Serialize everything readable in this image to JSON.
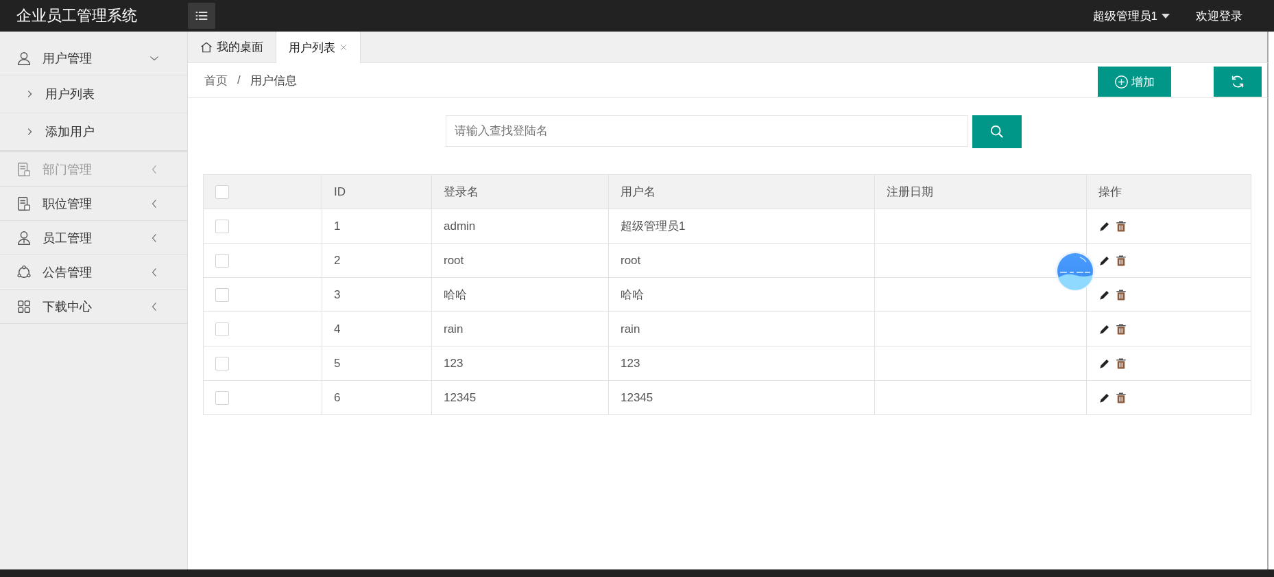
{
  "header": {
    "title": "企业员工管理系统",
    "user": "超级管理员1",
    "welcome": "欢迎登录"
  },
  "sidebar": {
    "items": [
      {
        "label": "用户管理",
        "kind": "person",
        "expanded": true,
        "disabled": false,
        "children": [
          {
            "label": "用户列表"
          },
          {
            "label": "添加用户"
          }
        ]
      },
      {
        "label": "部门管理",
        "kind": "doc",
        "expanded": false,
        "disabled": true
      },
      {
        "label": "职位管理",
        "kind": "doc",
        "expanded": false,
        "disabled": false
      },
      {
        "label": "员工管理",
        "kind": "staff",
        "expanded": false,
        "disabled": false
      },
      {
        "label": "公告管理",
        "kind": "share",
        "expanded": false,
        "disabled": false
      },
      {
        "label": "下载中心",
        "kind": "grid",
        "expanded": false,
        "disabled": false
      }
    ]
  },
  "tabs": [
    {
      "label": "我的桌面",
      "kind": "home",
      "selected": false
    },
    {
      "label": "用户列表",
      "kind": "closable",
      "selected": true
    }
  ],
  "breadcrumb": {
    "separator": "/",
    "items": [
      "首页",
      "用户信息"
    ]
  },
  "toolbar": {
    "add_button": "增加"
  },
  "search": {
    "placeholder": "请输入查找登陆名"
  },
  "table": {
    "select_all_checked": false,
    "columns": [
      "ID",
      "登录名",
      "用户名",
      "注册日期",
      "操作"
    ],
    "rows": [
      {
        "checked": false,
        "cells": [
          "1",
          "admin",
          "超级管理员1",
          ""
        ]
      },
      {
        "checked": false,
        "cells": [
          "2",
          "root",
          "root",
          ""
        ]
      },
      {
        "checked": false,
        "cells": [
          "3",
          "哈哈",
          "哈哈",
          ""
        ]
      },
      {
        "checked": false,
        "cells": [
          "4",
          "rain",
          "rain",
          ""
        ]
      },
      {
        "checked": false,
        "cells": [
          "5",
          "123",
          "123",
          ""
        ]
      },
      {
        "checked": false,
        "cells": [
          "6",
          "12345",
          "12345",
          ""
        ]
      }
    ]
  }
}
